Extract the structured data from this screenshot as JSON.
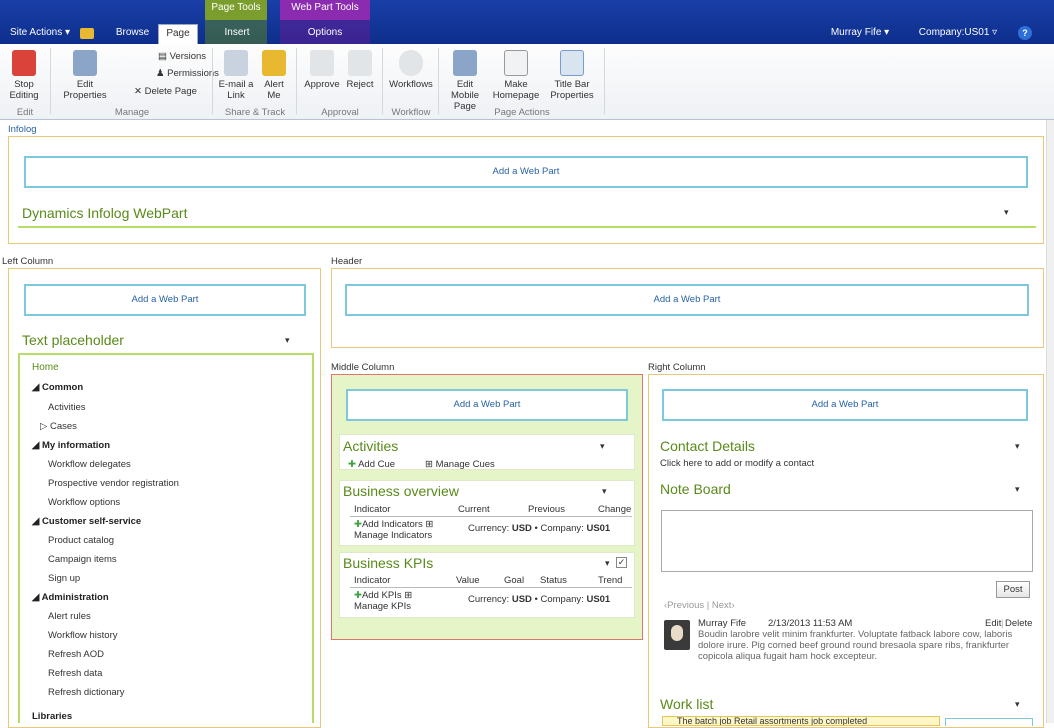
{
  "topbar": {
    "site_actions": "Site Actions",
    "browse": "Browse",
    "page": "Page",
    "insert": "Insert",
    "options": "Options",
    "page_tools": "Page Tools",
    "web_part_tools": "Web Part Tools",
    "user": "Murray Fife",
    "company": "Company:US01",
    "help": "?"
  },
  "ribbon": {
    "stop_editing": "Stop Editing",
    "edit_properties": "Edit Properties",
    "versions": "Versions",
    "permissions": "Permissions",
    "delete_page": "Delete Page",
    "email_link": "E-mail a Link",
    "alert_me": "Alert Me",
    "approve": "Approve",
    "reject": "Reject",
    "workflows": "Workflows",
    "edit_mobile": "Edit Mobile Page",
    "make_homepage": "Make Homepage",
    "title_bar": "Title Bar Properties",
    "groups": {
      "edit": "Edit",
      "manage": "Manage",
      "share": "Share & Track",
      "approval": "Approval",
      "workflow": "Workflow",
      "page_actions": "Page Actions"
    }
  },
  "zones": {
    "infolog": "Infolog",
    "left": "Left Column",
    "header": "Header",
    "middle": "Middle Column",
    "right": "Right Column",
    "add_web_part": "Add a Web Part"
  },
  "infolog_wp": "Dynamics Infolog WebPart",
  "text_placeholder": "Text placeholder",
  "nav": {
    "home": "Home",
    "common": "Common",
    "activities": "Activities",
    "cases": "Cases",
    "my_info": "My information",
    "workflow_delegates": "Workflow delegates",
    "prospective_vendor": "Prospective vendor registration",
    "workflow_options": "Workflow options",
    "customer_ss": "Customer self-service",
    "product_catalog": "Product catalog",
    "campaign_items": "Campaign items",
    "sign_up": "Sign up",
    "administration": "Administration",
    "alert_rules": "Alert rules",
    "workflow_history": "Workflow history",
    "refresh_aod": "Refresh AOD",
    "refresh_data": "Refresh data",
    "refresh_dictionary": "Refresh dictionary",
    "libraries": "Libraries"
  },
  "activities": {
    "title": "Activities",
    "add_cue": "Add Cue",
    "manage_cues": "Manage Cues"
  },
  "business_overview": {
    "title": "Business overview",
    "cols": [
      "Indicator",
      "Current",
      "Previous",
      "Change"
    ],
    "add": "Add Indicators",
    "manage": "Manage Indicators",
    "currency_label": "Currency:",
    "currency": "USD",
    "company_label": "Company:",
    "company": "US01"
  },
  "business_kpis": {
    "title": "Business KPIs",
    "cols": [
      "Indicator",
      "Value",
      "Goal",
      "Status",
      "Trend"
    ],
    "add": "Add KPIs",
    "manage": "Manage KPIs",
    "currency_label": "Currency:",
    "currency": "USD",
    "company_label": "Company:",
    "company": "US01"
  },
  "contact": {
    "title": "Contact Details",
    "link": "Click here to add or modify a contact"
  },
  "noteboard": {
    "title": "Note Board",
    "post": "Post",
    "previous": "Previous",
    "next": "Next",
    "author": "Murray Fife",
    "date": "2/13/2013 11:53 AM",
    "edit": "Edit",
    "delete": "Delete",
    "text": "Boudin larobre velit minim frankfurter. Voluptate fatback labore cow, laboris dolore irure. Pig corned beef ground round bresaola spare ribs, frankfurter copicola aliqua fugait ham hock excepteur."
  },
  "worklist": {
    "title": "Work list",
    "item": "The batch job Retail assortments job completed"
  }
}
